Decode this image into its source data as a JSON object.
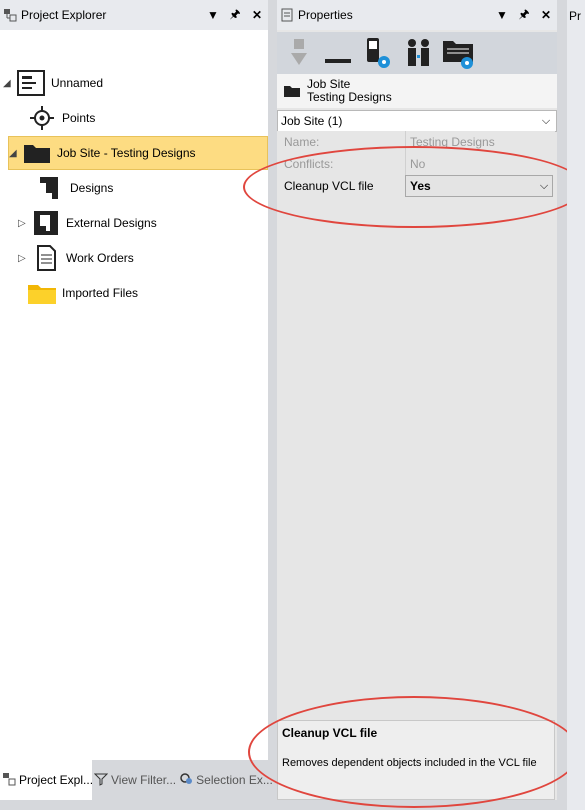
{
  "explorer": {
    "title": "Project Explorer",
    "tree": [
      {
        "label": "Unnamed"
      },
      {
        "label": "Points"
      },
      {
        "label": "Job Site - Testing Designs"
      },
      {
        "label": "Designs"
      },
      {
        "label": "External Designs"
      },
      {
        "label": "Work Orders"
      },
      {
        "label": "Imported Files"
      }
    ]
  },
  "bottom_tabs": [
    {
      "label": "Project Expl..."
    },
    {
      "label": "View Filter..."
    },
    {
      "label": "Selection Ex..."
    }
  ],
  "properties": {
    "title": "Properties",
    "header": {
      "line1": "Job Site",
      "line2": "Testing Designs"
    },
    "object_combo": "Job Site (1)",
    "rows": [
      {
        "key": "Name:",
        "value": "Testing Designs"
      },
      {
        "key": "Conflicts:",
        "value": "No"
      },
      {
        "key": "Cleanup VCL file",
        "value": "Yes"
      }
    ],
    "description": {
      "title": "Cleanup VCL file",
      "text": "Removes dependent objects included in the VCL file"
    }
  },
  "far_panel": {
    "title": "Pr"
  },
  "colors": {
    "selection": "#fddc82",
    "annotation": "#e0463e"
  },
  "icons": [
    "folder-icon",
    "gear-icon",
    "pin-icon",
    "close-icon",
    "chevron-down-icon"
  ]
}
